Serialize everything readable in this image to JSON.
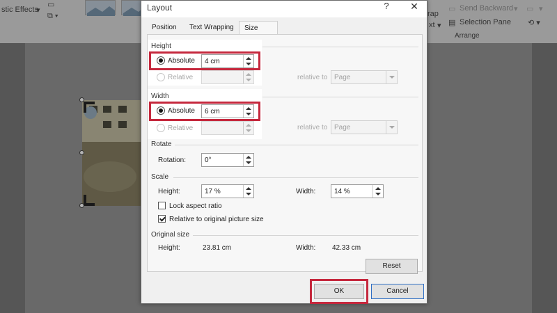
{
  "background_app": {
    "ribbon": {
      "artistic_effects_label": "stic Effects",
      "send_backward_label": "Send Backward",
      "selection_pane_label": "Selection Pane",
      "arrange_group_label": "Arrange",
      "wrap_text_label_1": "rap",
      "wrap_text_label_2": "xt"
    }
  },
  "dialog": {
    "title": "Layout",
    "help": "?",
    "close": "✕",
    "tabs": [
      {
        "label": "Position"
      },
      {
        "label": "Text Wrapping"
      },
      {
        "label": "Size"
      }
    ],
    "height": {
      "section_label": "Height",
      "absolute_label": "Absolute",
      "absolute_value": "4 cm",
      "relative_label": "Relative",
      "relative_value": "",
      "relative_to_label": "relative to",
      "relative_to_value": "Page"
    },
    "width": {
      "section_label": "Width",
      "absolute_label": "Absolute",
      "absolute_value": "6 cm",
      "relative_label": "Relative",
      "relative_value": "",
      "relative_to_label": "relative to",
      "relative_to_value": "Page"
    },
    "rotate": {
      "section_label": "Rotate",
      "rotation_label": "Rotation:",
      "rotation_value": "0°"
    },
    "scale": {
      "section_label": "Scale",
      "height_label": "Height:",
      "height_value": "17 %",
      "width_label": "Width:",
      "width_value": "14 %",
      "lock_aspect_label": "Lock aspect ratio",
      "lock_aspect_checked": false,
      "relative_original_label": "Relative to original picture size",
      "relative_original_checked": true
    },
    "original_size": {
      "section_label": "Original size",
      "height_label": "Height:",
      "height_value": "23.81 cm",
      "width_label": "Width:",
      "width_value": "42.33 cm",
      "reset_label": "Reset"
    },
    "ok_label": "OK",
    "cancel_label": "Cancel"
  },
  "colors": {
    "highlight_frame": "#c5283d",
    "dialog_bg": "#f0f0f0",
    "default_button_border": "#2f6fc4"
  }
}
